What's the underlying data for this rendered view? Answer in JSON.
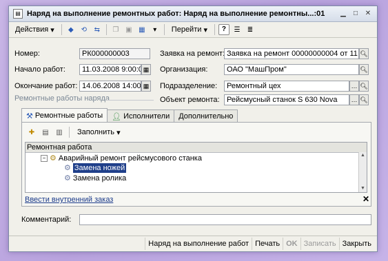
{
  "window": {
    "title": "Наряд на выполнение ремонтных работ: Наряд на выполнение ремонтны...:01"
  },
  "toolbar": {
    "actions_label": "Действия",
    "goto_label": "Перейти",
    "help_label": "?"
  },
  "form": {
    "number": {
      "label": "Номер:",
      "value": "РК000000003"
    },
    "start": {
      "label": "Начало работ:",
      "value": "11.03.2008  9:00:0"
    },
    "end": {
      "label": "Окончание работ:",
      "value": "14.06.2008 14:00:0"
    },
    "request": {
      "label": "Заявка на ремонт:",
      "value": "Заявка на ремонт 00000000004 от 11 ..."
    },
    "organization": {
      "label": "Организация:",
      "value": "ОАО \"МашПром\""
    },
    "department": {
      "label": "Подразделение:",
      "value": "Ремонтный цех"
    },
    "object": {
      "label": "Объект ремонта:",
      "value": "Рейсмусный станок S 630 Nova"
    }
  },
  "section_title": "Ремонтные работы наряда",
  "tabs": [
    "Ремонтные работы",
    "Исполнители",
    "Дополнительно"
  ],
  "subtoolbar": {
    "fill_label": "Заполнить"
  },
  "grid": {
    "header": "Ремонтная работа",
    "rows": [
      {
        "label": "Аварийный ремонт рейсмусового станка",
        "level": 0
      },
      {
        "label": "Замена ножей",
        "level": 1,
        "selected": true
      },
      {
        "label": "Замена ролика",
        "level": 1
      }
    ]
  },
  "link_text": "Ввести внутренний заказ",
  "comment": {
    "label": "Комментарий:",
    "value": ""
  },
  "footer": {
    "buttons": [
      "Наряд на выполнение работ",
      "Печать",
      "OK",
      "Записать",
      "Закрыть"
    ]
  },
  "colors": {
    "selection": "#1f3f8a",
    "link": "#1a3a8a"
  }
}
